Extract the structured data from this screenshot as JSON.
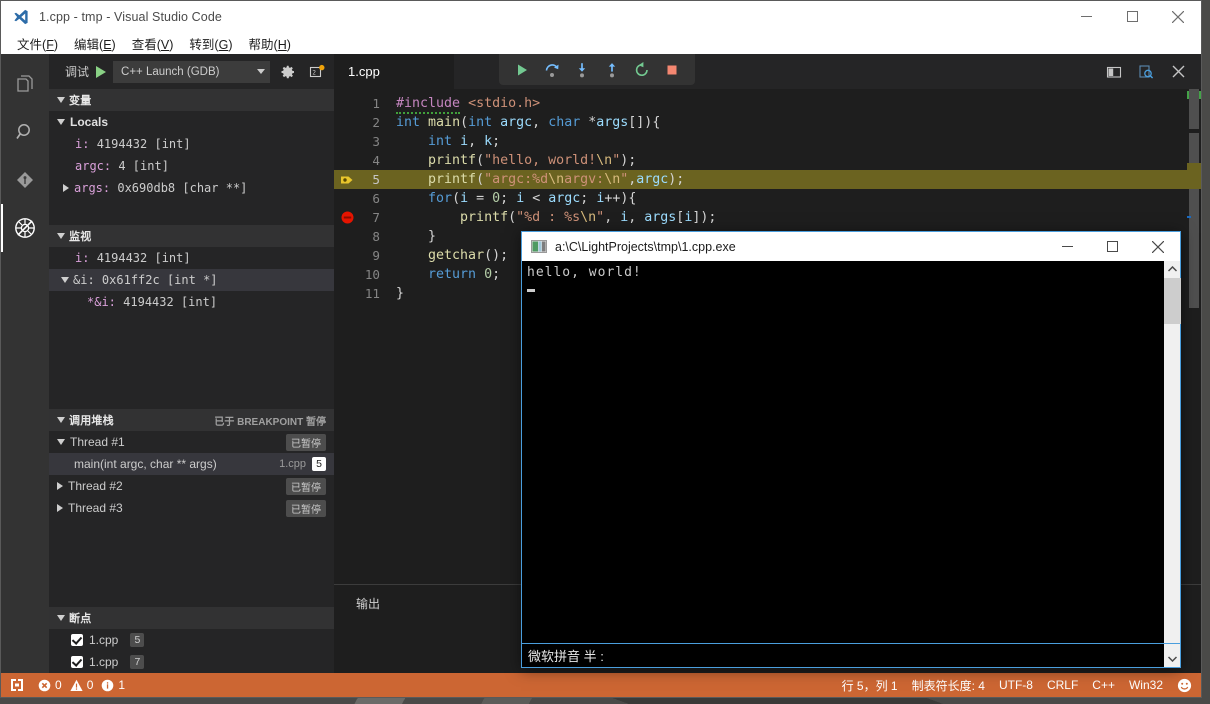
{
  "window": {
    "title": "1.cpp - tmp - Visual Studio Code",
    "minimize": "—",
    "maximize": "□",
    "close": "✕"
  },
  "menubar": [
    {
      "label": "文件",
      "accel": "F"
    },
    {
      "label": "编辑",
      "accel": "E"
    },
    {
      "label": "查看",
      "accel": "V"
    },
    {
      "label": "转到",
      "accel": "G"
    },
    {
      "label": "帮助",
      "accel": "H"
    }
  ],
  "activitybar": [
    {
      "name": "explorer-icon",
      "title": "资源管理器"
    },
    {
      "name": "search-icon",
      "title": "搜索"
    },
    {
      "name": "source-control-icon",
      "title": "源代码管理"
    },
    {
      "name": "debug-icon",
      "title": "调试"
    }
  ],
  "sidebar": {
    "toolbar": {
      "label": "调试",
      "start_icon": "play-icon",
      "config": "C++ Launch (GDB)",
      "gear_icon": "gear-icon",
      "open_config_icon": "open-debug-console-icon"
    },
    "variables": {
      "title": "变量",
      "groups": [
        {
          "label": "Locals",
          "expanded": true,
          "items": [
            {
              "name": "i",
              "value": "4194432 [int]",
              "expandable": false
            },
            {
              "name": "argc",
              "value": "4 [int]",
              "expandable": false
            },
            {
              "name": "args",
              "value": "0x690db8 [char **]",
              "expandable": true
            }
          ]
        }
      ]
    },
    "watch": {
      "title": "监视",
      "items": [
        {
          "name": "i",
          "value": "4194432 [int]",
          "expandable": false,
          "indent": 1,
          "selected": false
        },
        {
          "name": "&i",
          "value": "0x61ff2c [int *]",
          "expandable": true,
          "indent": 0,
          "selected": true
        },
        {
          "name": "*&i",
          "value": "4194432 [int]",
          "expandable": false,
          "indent": 2,
          "selected": false
        }
      ]
    },
    "callstack": {
      "title": "调用堆栈",
      "status": "已于 BREAKPOINT 暂停",
      "threads": [
        {
          "label": "Thread #1",
          "state": "已暂停",
          "expanded": true,
          "frames": [
            {
              "label": "main(int argc, char ** args)",
              "file": "1.cpp",
              "line": "5"
            }
          ]
        },
        {
          "label": "Thread #2",
          "state": "已暂停",
          "expanded": false,
          "frames": []
        },
        {
          "label": "Thread #3",
          "state": "已暂停",
          "expanded": false,
          "frames": []
        }
      ]
    },
    "breakpoints": {
      "title": "断点",
      "items": [
        {
          "file": "1.cpp",
          "line": "5",
          "checked": true
        },
        {
          "file": "1.cpp",
          "line": "7",
          "checked": true
        }
      ]
    }
  },
  "editor": {
    "tab": "1.cpp",
    "actions": [
      {
        "name": "split-editor-icon"
      },
      {
        "name": "preview-icon"
      },
      {
        "name": "close-icon"
      }
    ],
    "debug_toolbar": [
      {
        "name": "continue-icon",
        "title": "继续"
      },
      {
        "name": "step-over-icon",
        "title": "单步跳过"
      },
      {
        "name": "step-into-icon",
        "title": "单步调试"
      },
      {
        "name": "step-out-icon",
        "title": "单步跳出"
      },
      {
        "name": "restart-icon",
        "title": "重启"
      },
      {
        "name": "stop-icon",
        "title": "停止"
      }
    ],
    "current_line": 5,
    "lines": [
      {
        "n": "1",
        "glyph": "none",
        "highlight": false
      },
      {
        "n": "2",
        "glyph": "none",
        "highlight": false
      },
      {
        "n": "3",
        "glyph": "none",
        "highlight": false
      },
      {
        "n": "4",
        "glyph": "none",
        "highlight": false
      },
      {
        "n": "5",
        "glyph": "current-breakpoint",
        "highlight": true
      },
      {
        "n": "6",
        "glyph": "none",
        "highlight": false
      },
      {
        "n": "7",
        "glyph": "breakpoint",
        "highlight": false
      },
      {
        "n": "8",
        "glyph": "none",
        "highlight": false
      },
      {
        "n": "9",
        "glyph": "none",
        "highlight": false
      },
      {
        "n": "10",
        "glyph": "none",
        "highlight": false
      },
      {
        "n": "11",
        "glyph": "none",
        "highlight": false
      }
    ],
    "code": [
      "#include <stdio.h>",
      "int main(int argc, char *args[]){",
      "    int i, k;",
      "    printf(\"hello, world!\\n\");",
      "    printf(\"argc:%d\\nargv:\\n\",argc);",
      "    for(i = 0; i < argc; i++){",
      "        printf(\"%d : %s\\n\", i, args[i]);",
      "    }",
      "    getchar();",
      "    return 0;",
      "}"
    ]
  },
  "panel": {
    "title": "输出"
  },
  "console": {
    "title": "a:\\C\\LightProjects\\tmp\\1.cpp.exe",
    "minimize": "—",
    "maximize": "□",
    "close": "✕",
    "output": "hello, world!",
    "ime": "微软拼音  半  :"
  },
  "statusbar": {
    "remote_icon": "remote-window-icon",
    "errors": "0",
    "warnings": "0",
    "infos": "1",
    "cursor": "行 5，列 1",
    "tabsize": "制表符长度: 4",
    "encoding": "UTF-8",
    "eol": "CRLF",
    "language": "C++",
    "platform": "Win32",
    "feedback_icon": "smiley-icon",
    "bg_color": "#cc6633"
  }
}
